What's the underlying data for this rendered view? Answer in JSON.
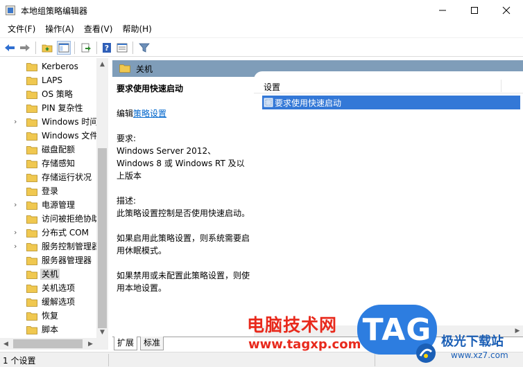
{
  "window": {
    "title": "本地组策略编辑器"
  },
  "menu": {
    "items": [
      "文件(F)",
      "操作(A)",
      "查看(V)",
      "帮助(H)"
    ]
  },
  "tree": {
    "items": [
      {
        "label": "Kerberos",
        "expandable": false
      },
      {
        "label": "LAPS",
        "expandable": false
      },
      {
        "label": "OS 策略",
        "expandable": false
      },
      {
        "label": "PIN 复杂性",
        "expandable": false
      },
      {
        "label": "Windows 时间",
        "expandable": true
      },
      {
        "label": "Windows 文件",
        "expandable": false
      },
      {
        "label": "磁盘配额",
        "expandable": false
      },
      {
        "label": "存储感知",
        "expandable": false
      },
      {
        "label": "存储运行状况",
        "expandable": false
      },
      {
        "label": "登录",
        "expandable": false
      },
      {
        "label": "电源管理",
        "expandable": true
      },
      {
        "label": "访问被拒绝协助",
        "expandable": false
      },
      {
        "label": "分布式 COM",
        "expandable": true
      },
      {
        "label": "服务控制管理器",
        "expandable": true
      },
      {
        "label": "服务器管理器",
        "expandable": false
      },
      {
        "label": "关机",
        "expandable": false,
        "selected": true
      },
      {
        "label": "关机选项",
        "expandable": false
      },
      {
        "label": "缓解选项",
        "expandable": false
      },
      {
        "label": "恢复",
        "expandable": false
      },
      {
        "label": "脚本",
        "expandable": false
      }
    ]
  },
  "right_header": {
    "label": "关机"
  },
  "description": {
    "title": "要求使用快速启动",
    "edit_prefix": "编辑",
    "edit_link": "策略设置",
    "requirements_label": "要求:",
    "requirements_text": "Windows Server 2012、Windows 8 或 Windows RT 及以上版本",
    "description_label": "描述:",
    "description_text": "此策略设置控制是否使用快速启动。",
    "enabled_text": "如果启用此策略设置，则系统需要启用休眠模式。",
    "disabled_text": "如果禁用或未配置此策略设置，则使用本地设置。"
  },
  "settings": {
    "column_header": "设置",
    "rows": [
      "要求使用快速启动"
    ]
  },
  "tabs": {
    "extended": "扩展",
    "standard": "标准"
  },
  "status": {
    "text": "1 个设置"
  },
  "watermark": {
    "cn_text": "电脑技术网",
    "url": "www.tagxp.com",
    "tag": "TAG",
    "site_name": "极光下载站",
    "site_url": "www.xz7.com"
  },
  "colors": {
    "selection_blue": "#3378d7",
    "header_blue": "#7f9db9",
    "folder_yellow": "#f0c850",
    "watermark_red": "#e8291c",
    "watermark_blue": "#2d7de0"
  }
}
